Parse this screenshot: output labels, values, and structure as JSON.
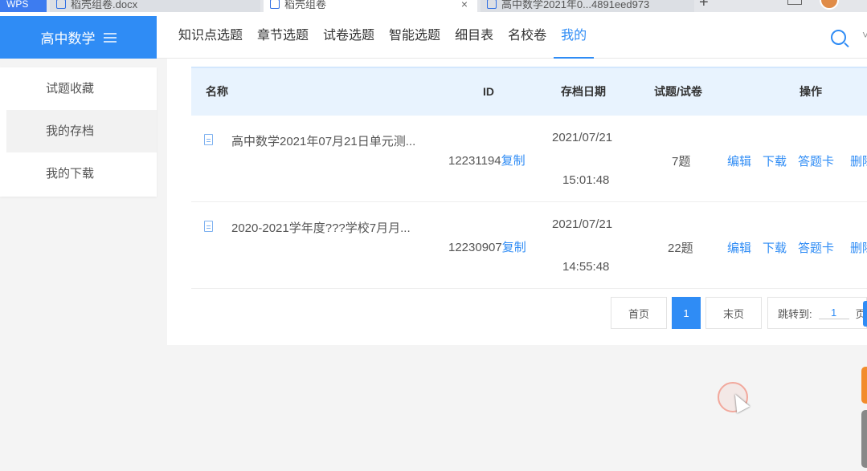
{
  "browser": {
    "tabs": [
      {
        "label": "WPS"
      },
      {
        "label": "稻壳组卷.docx"
      },
      {
        "label": "稻壳组卷"
      },
      {
        "label": "高中数学2021年0...4891eed973"
      }
    ],
    "new_tab": "+",
    "close_glyph": "×"
  },
  "brand": {
    "title": "高中数学"
  },
  "nav": {
    "items": [
      "知识点选题",
      "章节选题",
      "试卷选题",
      "智能选题",
      "细目表",
      "名校卷",
      "我的"
    ],
    "active_index": 6
  },
  "sidebar": {
    "items": [
      "试题收藏",
      "我的存档",
      "我的下载"
    ],
    "active_index": 1
  },
  "table": {
    "headers": {
      "name": "名称",
      "id": "ID",
      "date": "存档日期",
      "count": "试题/试卷",
      "ops": "操作"
    },
    "rows": [
      {
        "name": "高中数学2021年07月21日单元测...",
        "id": "12231194",
        "copy": "复制",
        "date": "2021/07/21",
        "time": "15:01:48",
        "count": "7题"
      },
      {
        "name": "2020-2021学年度???学校7月月...",
        "id": "12230907",
        "copy": "复制",
        "date": "2021/07/21",
        "time": "14:55:48",
        "count": "22题"
      }
    ],
    "actions": [
      "编辑",
      "下载",
      "答题卡",
      "删除"
    ]
  },
  "pagination": {
    "first": "首页",
    "current": "1",
    "last": "末页",
    "jump_label": "跳转到:",
    "jump_value": "1",
    "page_unit": "页"
  },
  "colors": {
    "accent": "#2f8cf5",
    "header_bg": "#e8f3fe"
  }
}
